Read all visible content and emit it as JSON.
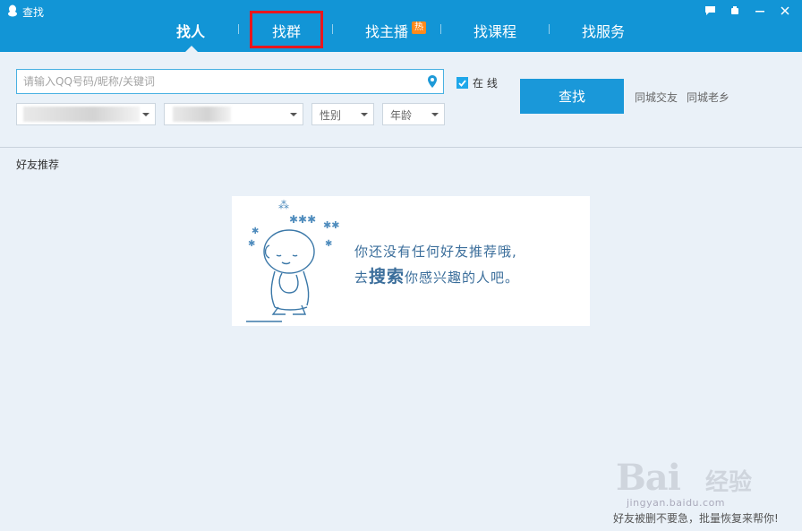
{
  "window": {
    "title": "查找",
    "controls": [
      "feedback-icon",
      "skin-icon",
      "minimize-icon",
      "close-icon"
    ]
  },
  "tabs": [
    {
      "label": "找人",
      "active": true
    },
    {
      "label": "找群",
      "active": false
    },
    {
      "label": "找主播",
      "active": false,
      "badge": "热"
    },
    {
      "label": "找课程",
      "active": false
    },
    {
      "label": "找服务",
      "active": false
    }
  ],
  "search": {
    "placeholder": "请输入QQ号码/昵称/关键词",
    "value": ""
  },
  "filters": {
    "online_label": "在 线",
    "online_checked": true,
    "gender_label": "性别",
    "age_label": "年龄"
  },
  "actions": {
    "find_label": "查找",
    "same_city_friends": "同城交友",
    "same_city_hometown": "同城老乡"
  },
  "section": {
    "title": "好友推荐"
  },
  "empty": {
    "line1": "你还没有任何好友推荐哦,",
    "line2_prefix": "去",
    "line2_big": "搜索",
    "line2_suffix": "你感兴趣的人吧。"
  },
  "watermark": {
    "logo": "Bai",
    "logo_cn": "经验",
    "url": "jingyan.baidu.com"
  },
  "tip": "好友被删不要急，批量恢复来帮你!",
  "colors": {
    "accent": "#1295d6",
    "button": "#1a98d9",
    "highlight": "#e8161d"
  }
}
